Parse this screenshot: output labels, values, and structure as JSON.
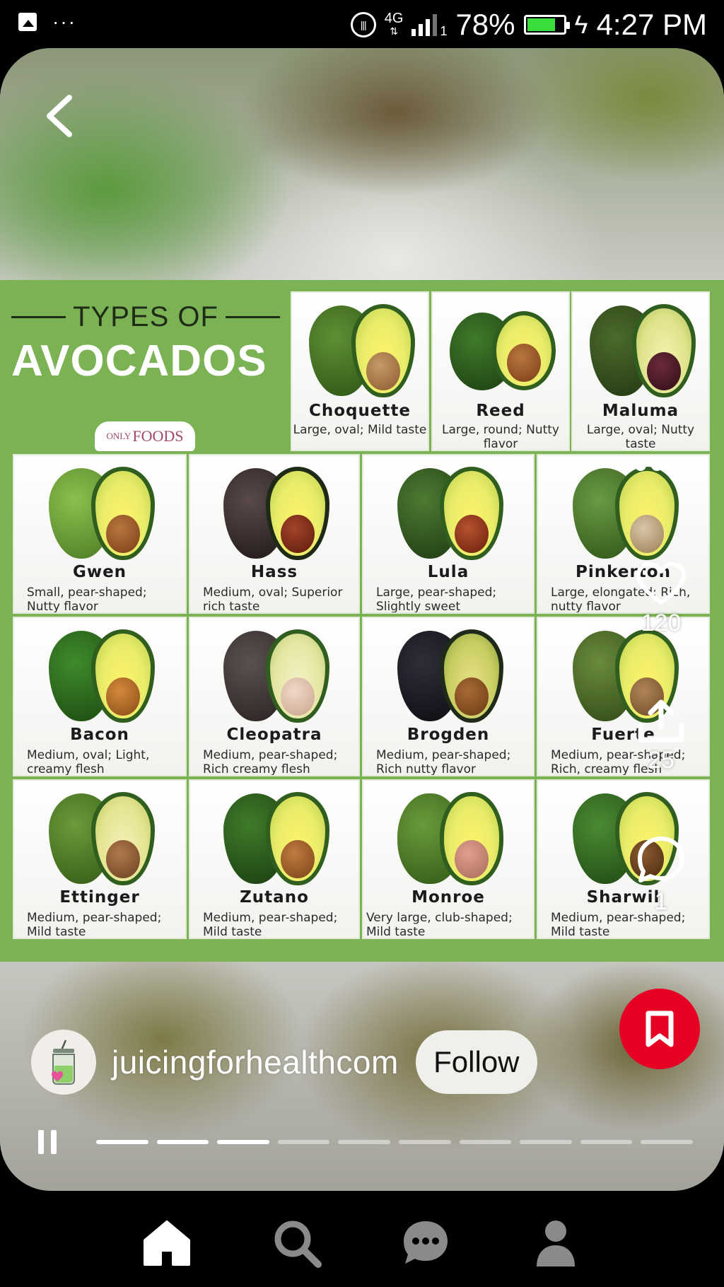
{
  "status_bar": {
    "network": "4G",
    "sim": "1",
    "battery": "78%",
    "battery_level": 0.78,
    "time": "4:27 PM"
  },
  "infographic": {
    "heading": "TYPES OF",
    "title": "AVOCADOS",
    "brand_prefix": "ONLY",
    "brand_name": "FOODS",
    "varieties": [
      {
        "name": "Choquette",
        "desc": "Large, oval; Mild taste"
      },
      {
        "name": "Reed",
        "desc": "Large, round; Nutty flavor"
      },
      {
        "name": "Maluma",
        "desc": "Large, oval; Nutty taste"
      },
      {
        "name": "Gwen",
        "desc": "Small, pear-shaped; Nutty flavor"
      },
      {
        "name": "Hass",
        "desc": "Medium, oval; Superior rich taste"
      },
      {
        "name": "Lula",
        "desc": "Large, pear-shaped; Slightly sweet"
      },
      {
        "name": "Pinkerton",
        "desc": "Large, elongated; Rich, nutty flavor"
      },
      {
        "name": "Bacon",
        "desc": "Medium, oval; Light, creamy flesh"
      },
      {
        "name": "Cleopatra",
        "desc": "Medium, pear-shaped; Rich creamy flesh"
      },
      {
        "name": "Brogden",
        "desc": "Medium, pear-shaped; Rich nutty flavor"
      },
      {
        "name": "Fuerte",
        "desc": "Medium, pear-shaped; Rich, creamy flesh"
      },
      {
        "name": "Ettinger",
        "desc": "Medium, pear-shaped; Mild taste"
      },
      {
        "name": "Zutano",
        "desc": "Medium, pear-shaped; Mild taste"
      },
      {
        "name": "Monroe",
        "desc": "Very large, club-shaped; Mild taste"
      },
      {
        "name": "Sharwil",
        "desc": "Medium, pear-shaped; Mild taste"
      }
    ]
  },
  "actions": {
    "like_count": "120",
    "share_count": "25",
    "comment_count": "1"
  },
  "creator": {
    "name": "juicingforhealthcom",
    "follow_label": "Follow"
  },
  "progress": {
    "segments_total": 10,
    "segments_viewed": 3
  },
  "colors": {
    "save_red": "#e60023",
    "infographic_green": "#7bb254",
    "battery_green": "#3ddc3d"
  },
  "icons": [
    "back-arrow-icon",
    "heart-icon",
    "share-icon",
    "comment-icon",
    "bookmark-icon",
    "pause-icon",
    "home-icon",
    "search-icon",
    "messages-icon",
    "profile-icon"
  ]
}
